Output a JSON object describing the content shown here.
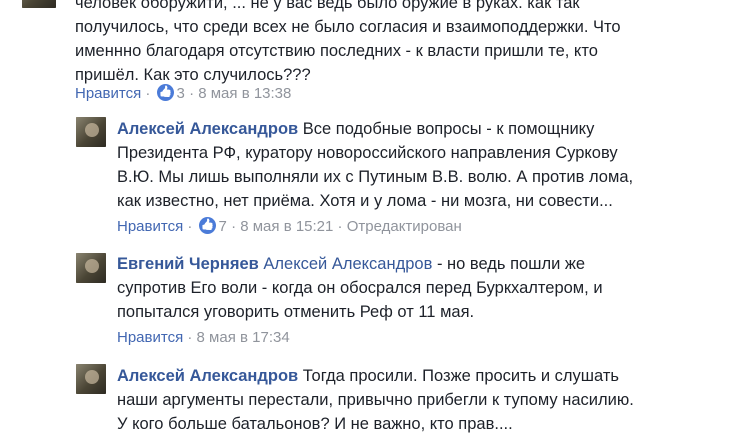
{
  "comments": [
    {
      "id": "top",
      "author": "",
      "text_lines": [
        "человек оборужити, ... не у вас ведь было оружие в руках. как так",
        "получилось, что среди всех не было согласия и взаимоподдержки. Что",
        "именнно благодаря отсутствию последних - к власти пришли те, кто",
        "пришёл. Как это случилось???"
      ],
      "like_label": "Нравится",
      "like_count": "3",
      "time": "8 мая в 13:38"
    },
    {
      "id": "reply1",
      "author": "Алексей Александров",
      "text_first": "Все подобные вопросы - к помощнику",
      "text_lines": [
        "Президента РФ, куратору новороссийского направления Суркову",
        "В.Ю. Мы лишь выполняли их с Путиным В.В. волю. А против лома,",
        "как известно, нет приёма. Хотя и у лома - ни мозга, ни совести..."
      ],
      "like_label": "Нравится",
      "like_count": "7",
      "time": "8 мая в 15:21",
      "edited": "Отредактирован"
    },
    {
      "id": "reply2",
      "author": "Евгений Черняев",
      "mention": "Алексей Александров",
      "text_first": "- но ведь пошли же",
      "text_lines": [
        "супротив Его воли - когда он обосрался перед Буркхалтером, и",
        "попытался уговорить отменить Реф от 11 мая."
      ],
      "like_label": "Нравится",
      "time": "8 мая в 17:34"
    },
    {
      "id": "reply3",
      "author": "Алексей Александров",
      "text_first": "Тогда просили. Позже просить и слушать",
      "text_lines": [
        "наши аргументы перестали, привычно прибегли к тупому насилию.",
        "У кого больше батальонов? И не важно, кто прав...."
      ]
    }
  ],
  "separator": "·",
  "colors": {
    "link": "#365899",
    "meta": "#90949c",
    "badge": "#4b7bd8"
  },
  "icons": {
    "like_badge": "thumbs-up-icon",
    "avatar": "user-avatar"
  }
}
